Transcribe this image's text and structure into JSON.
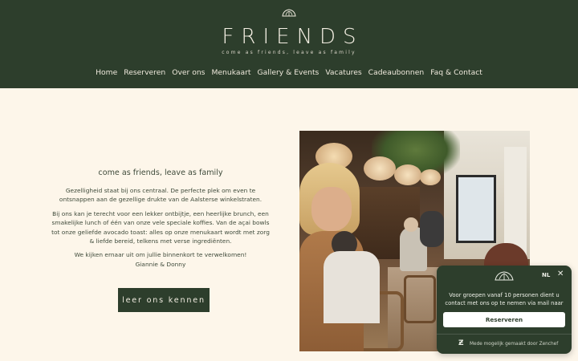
{
  "header": {
    "brand": "FRIENDS",
    "tagline": "come as friends, leave as family",
    "logo_icon": "croissant-icon",
    "nav": [
      {
        "label": "Home"
      },
      {
        "label": "Reserveren"
      },
      {
        "label": "Over ons"
      },
      {
        "label": "Menukaart"
      },
      {
        "label": "Gallery & Events"
      },
      {
        "label": "Vacatures"
      },
      {
        "label": "Cadeaubonnen"
      },
      {
        "label": "Faq & Contact"
      }
    ]
  },
  "intro": {
    "title": "come as friends, leave as family",
    "paragraph1": "Gezelligheid staat bij ons centraal. De perfecte plek om even te ontsnappen aan de gezellige drukte van de Aalsterse winkelstraten.",
    "paragraph2": "Bij ons kan je terecht voor een lekker ontbijtje, een heerlijke brunch, een smakelijke lunch of één van onze vele speciale koffies. Van de açai bowls tot onze geliefde avocado toast: alles op onze menukaart wordt met zorg & liefde bereid, telkens met verse ingrediënten.",
    "welcome": "We kijken ernaar uit om jullie binnenkort te verwelkomen!",
    "signature": "Giannie & Donny",
    "cta_label": "leer ons kennen"
  },
  "widget": {
    "language": "NL",
    "close_icon": "close-icon",
    "message": "Voor groepen vanaf 10 personen dient u contact met ons op te nemen via mail naar",
    "button_label": "Reserveren",
    "footer": "Mede mogelijk gemaakt door Zenchef"
  },
  "colors": {
    "primary": "#2d3e2c",
    "background": "#fdf6ea",
    "text": "#3e4a3a"
  }
}
